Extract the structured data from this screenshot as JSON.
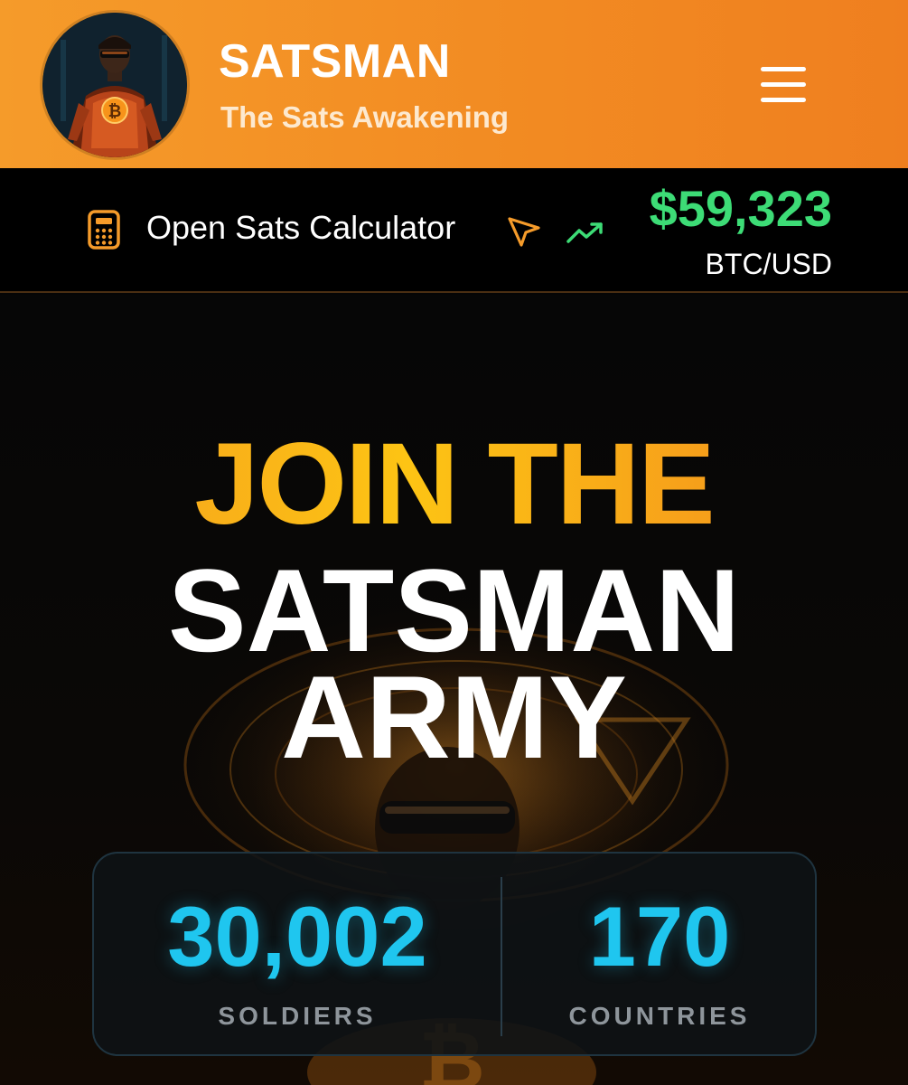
{
  "header": {
    "title": "SATSMAN",
    "subtitle": "The Sats Awakening",
    "avatar_icon": "satsman-hero-avatar",
    "menu_icon": "hamburger-menu-icon",
    "background_color": "#f28a22"
  },
  "ticker": {
    "calculator_label": "Open Sats Calculator",
    "calculator_icon": "calculator-icon",
    "cursor_icon": "pointer-cursor-icon",
    "trend_icon": "trending-up-icon",
    "btc_price": "$59,323",
    "btc_pair": "BTC/USD",
    "price_color": "#3ddc76"
  },
  "hero": {
    "headline_top": "JOIN THE",
    "headline_line2": "SATSMAN",
    "headline_line3": "ARMY"
  },
  "stats": {
    "soldiers_value": "30,002",
    "soldiers_label": "SOLDIERS",
    "countries_value": "170",
    "countries_label": "COUNTRIES",
    "value_color": "#1fc6ef"
  }
}
